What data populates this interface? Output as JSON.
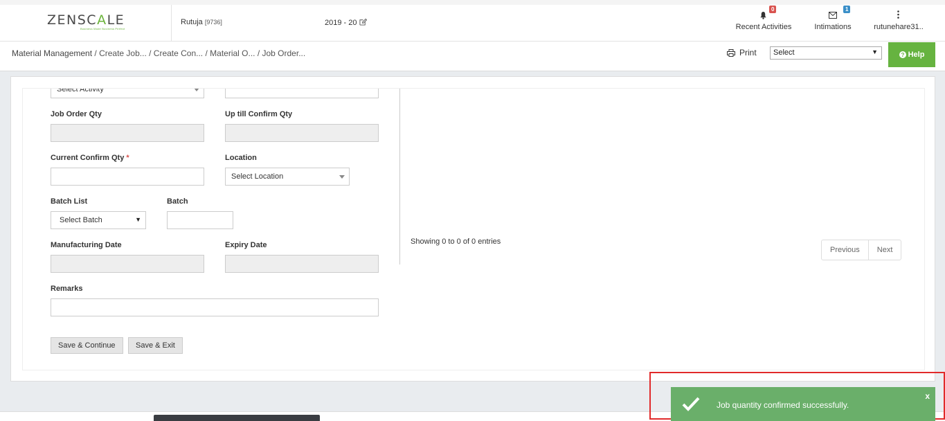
{
  "header": {
    "logo_left": "ZENSC",
    "logo_mid": "A",
    "logo_right": "LE",
    "logo_tagline": "Business Made Business Perfect",
    "user_name": "Rutuja",
    "user_code": "[9736]",
    "fiscal_year": "2019 - 20",
    "recent_activities_label": "Recent Activities",
    "recent_activities_count": "0",
    "intimations_label": "Intimations",
    "intimations_count": "1",
    "account_label": "rutunehare31.."
  },
  "breadcrumb": {
    "root": "Material Management",
    "trail": "/ Create Job... / Create Con... / Material O... / Job Order..."
  },
  "toolbar": {
    "print_label": "Print",
    "select_value": "Select",
    "help_label": "Help"
  },
  "form": {
    "activity_select": "Select Activity",
    "job_order_qty_label": "Job Order Qty",
    "up_till_confirm_qty_label": "Up till Confirm Qty",
    "current_confirm_qty_label": "Current Confirm Qty",
    "required_mark": "*",
    "location_label": "Location",
    "location_select": "Select Location",
    "batch_list_label": "Batch List",
    "batch_select": "Select Batch",
    "batch_label": "Batch",
    "manufacturing_date_label": "Manufacturing Date",
    "expiry_date_label": "Expiry Date",
    "remarks_label": "Remarks",
    "save_continue_label": "Save & Continue",
    "save_exit_label": "Save & Exit"
  },
  "table": {
    "entries_info": "Showing 0 to 0 of 0 entries",
    "previous_label": "Previous",
    "next_label": "Next"
  },
  "toast": {
    "message": "Job quantity confirmed successfully.",
    "close_label": "x"
  },
  "colors": {
    "accent_green": "#66b340",
    "toast_green": "#6aaf6a",
    "highlight_red": "#e12a2a"
  }
}
